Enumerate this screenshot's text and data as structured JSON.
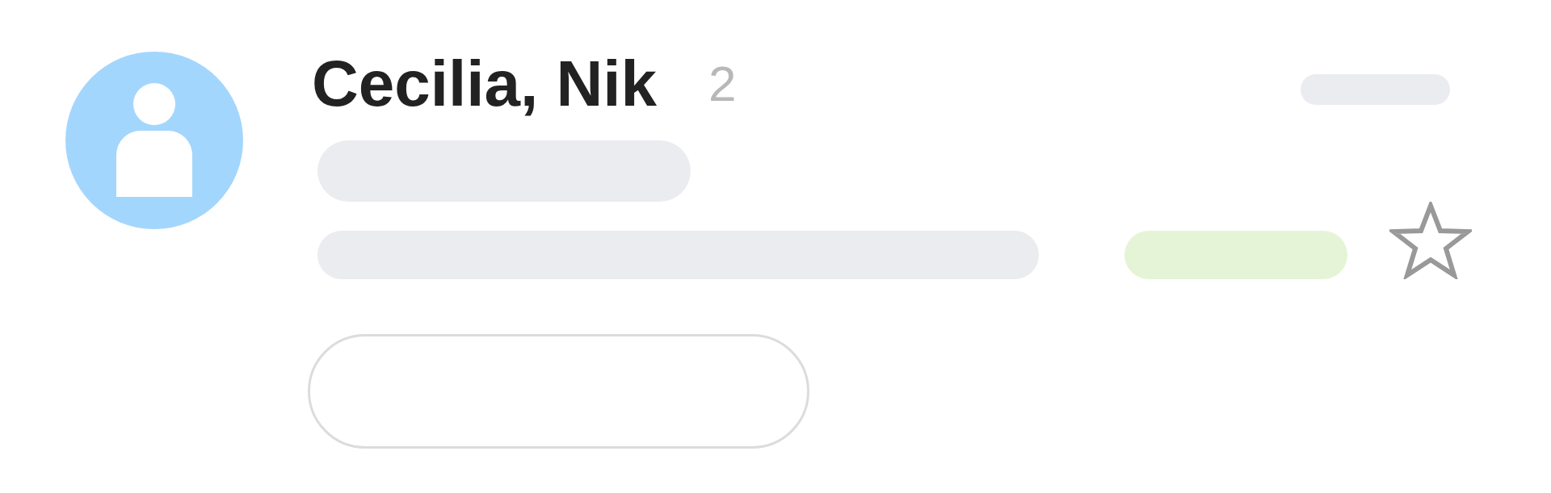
{
  "message": {
    "sender": "Cecilia, Nik",
    "count": "2",
    "starred": false
  }
}
